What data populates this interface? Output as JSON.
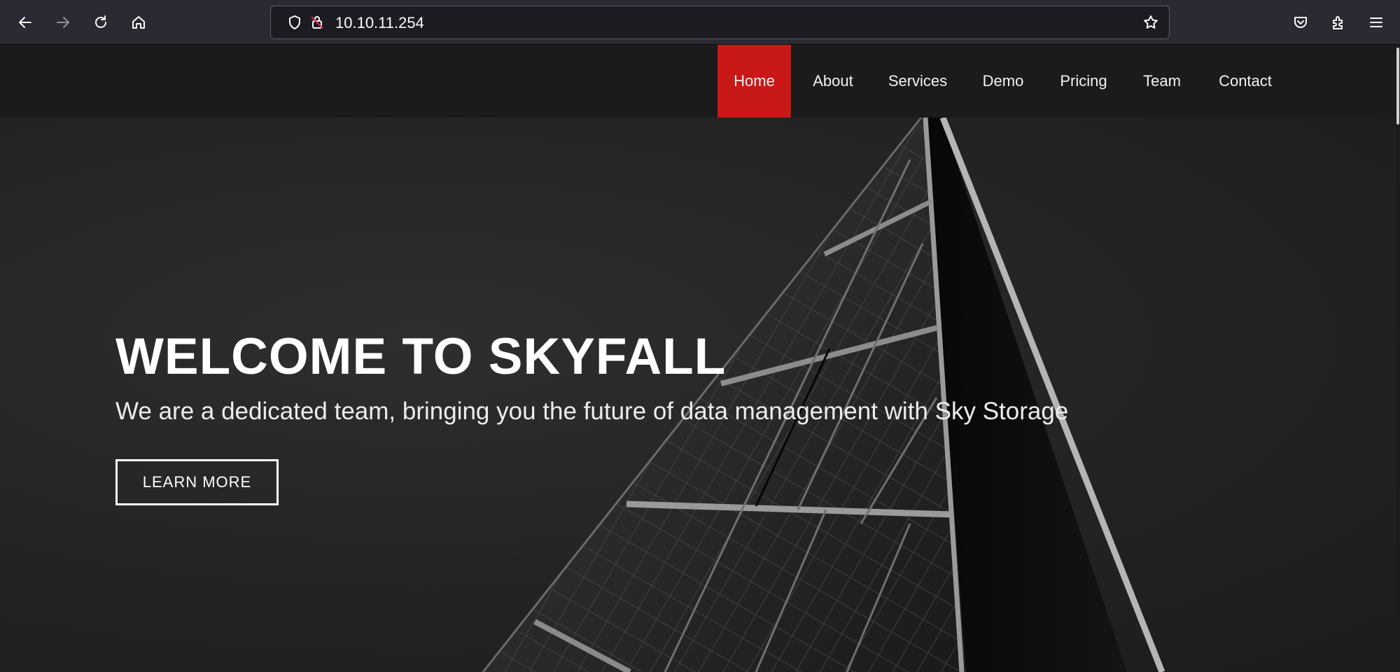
{
  "browser": {
    "url": "10.10.11.254",
    "icons": [
      "back-icon",
      "forward-icon",
      "reload-icon",
      "home-icon",
      "shield-icon",
      "insecure-lock-icon",
      "bookmark-star-icon",
      "pocket-icon",
      "extensions-icon",
      "menu-icon"
    ]
  },
  "nav": {
    "items": [
      {
        "label": "Home",
        "active": true
      },
      {
        "label": "About"
      },
      {
        "label": "Services"
      },
      {
        "label": "Demo"
      },
      {
        "label": "Pricing"
      },
      {
        "label": "Team"
      },
      {
        "label": "Contact"
      }
    ]
  },
  "hero": {
    "title": "WELCOME TO SKYFALL",
    "subtitle": "We are a dedicated team, bringing you the future of data management with Sky Storage",
    "button_label": "LEARN MORE"
  },
  "colors": {
    "accent_red": "#c91818",
    "navbar_bg": "#1b1b1b",
    "browser_toolbar": "#2b2a33"
  }
}
